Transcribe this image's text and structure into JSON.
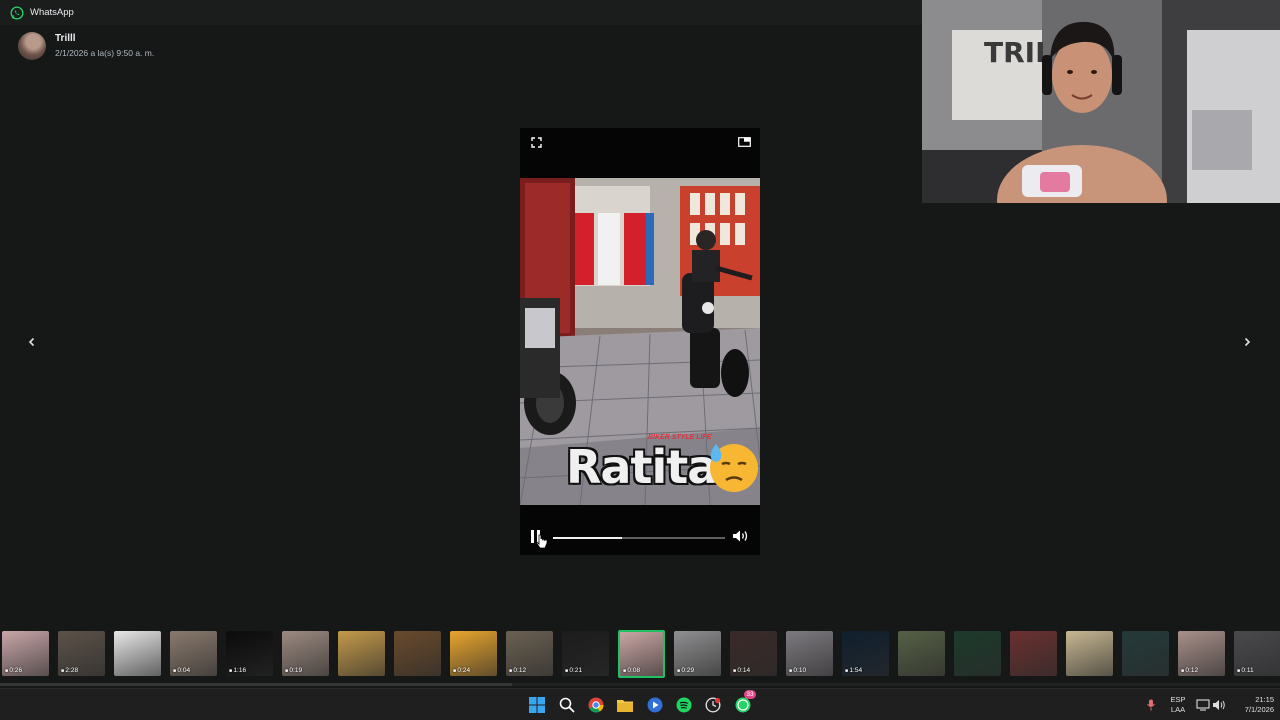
{
  "app": {
    "title": "WhatsApp",
    "brand_color": "#25d366"
  },
  "sender": {
    "name": "Trilll",
    "timestamp": "2/1/2026 a la(s) 9:50 a. m."
  },
  "player": {
    "caption": "Ratita",
    "caption_tag": "BIKER STYLE LIFE",
    "progress_fraction": 0.4,
    "state": "playing",
    "icons": [
      "fullscreen-icon",
      "picture-in-picture-icon",
      "pause-icon",
      "volume-icon"
    ]
  },
  "navigation": {
    "prev_icon": "chevron-left-icon",
    "next_icon": "chevron-right-icon"
  },
  "thumbnails": [
    {
      "duration": "0:26",
      "color": "#c9a6a8"
    },
    {
      "duration": "2:28",
      "color": "#5c5249"
    },
    {
      "duration": "",
      "color": "#e8e8e8"
    },
    {
      "duration": "0:04",
      "color": "#8a7a6d"
    },
    {
      "duration": "1:16",
      "color": "#0b0b0b"
    },
    {
      "duration": "0:19",
      "color": "#9c8a80"
    },
    {
      "duration": "",
      "color": "#c49a4a"
    },
    {
      "duration": "",
      "color": "#6a4a2c"
    },
    {
      "duration": "0:24",
      "color": "#e9a52d"
    },
    {
      "duration": "0:12",
      "color": "#6b6152"
    },
    {
      "duration": "0:21",
      "color": "#1c1c1c"
    },
    {
      "duration": "0:08",
      "color": "#caa6a4"
    },
    {
      "duration": "0:29",
      "color": "#8f8f91"
    },
    {
      "duration": "0:14",
      "color": "#3a2a28"
    },
    {
      "duration": "0:10",
      "color": "#7e7a80"
    },
    {
      "duration": "1:54",
      "color": "#0f1f2e"
    },
    {
      "duration": "",
      "color": "#556045"
    },
    {
      "duration": "",
      "color": "#1c3a2b"
    },
    {
      "duration": "",
      "color": "#6b3030"
    },
    {
      "duration": "",
      "color": "#c8b892"
    },
    {
      "duration": "",
      "color": "#243a3a"
    },
    {
      "duration": "0:12",
      "color": "#a8908a"
    },
    {
      "duration": "0:11",
      "color": "#4a4a4e"
    }
  ],
  "selected_thumbnail_index": 11,
  "taskbar": {
    "icons": [
      "windows-start-icon",
      "search-icon",
      "chrome-icon",
      "file-explorer-icon",
      "media-player-icon",
      "spotify-icon",
      "clock-app-icon",
      "whatsapp-icon"
    ],
    "whatsapp_badge": "33",
    "language_top": "ESP",
    "language_bottom": "LAA",
    "time": "21:15",
    "date": "7/1/2026"
  }
}
